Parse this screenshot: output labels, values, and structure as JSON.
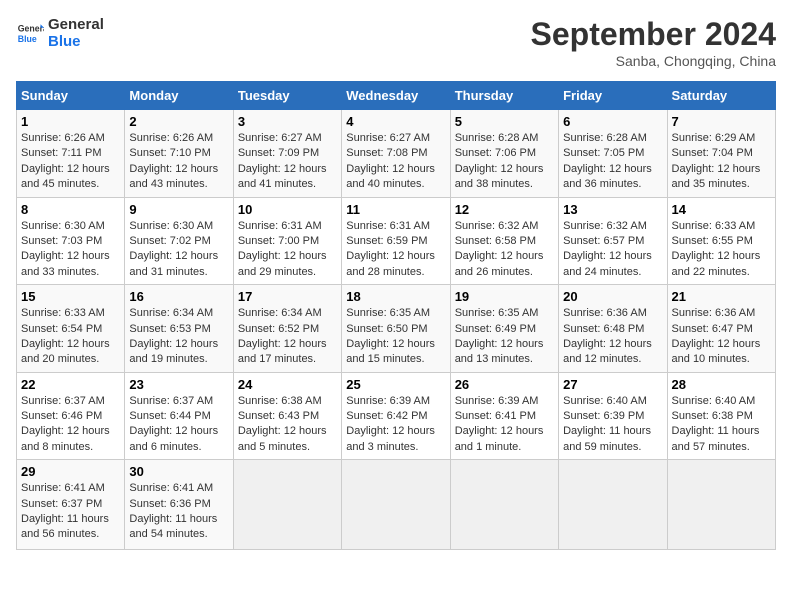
{
  "header": {
    "logo_line1": "General",
    "logo_line2": "Blue",
    "month": "September 2024",
    "location": "Sanba, Chongqing, China"
  },
  "weekdays": [
    "Sunday",
    "Monday",
    "Tuesday",
    "Wednesday",
    "Thursday",
    "Friday",
    "Saturday"
  ],
  "weeks": [
    [
      {
        "day": "1",
        "info": "Sunrise: 6:26 AM\nSunset: 7:11 PM\nDaylight: 12 hours\nand 45 minutes."
      },
      {
        "day": "2",
        "info": "Sunrise: 6:26 AM\nSunset: 7:10 PM\nDaylight: 12 hours\nand 43 minutes."
      },
      {
        "day": "3",
        "info": "Sunrise: 6:27 AM\nSunset: 7:09 PM\nDaylight: 12 hours\nand 41 minutes."
      },
      {
        "day": "4",
        "info": "Sunrise: 6:27 AM\nSunset: 7:08 PM\nDaylight: 12 hours\nand 40 minutes."
      },
      {
        "day": "5",
        "info": "Sunrise: 6:28 AM\nSunset: 7:06 PM\nDaylight: 12 hours\nand 38 minutes."
      },
      {
        "day": "6",
        "info": "Sunrise: 6:28 AM\nSunset: 7:05 PM\nDaylight: 12 hours\nand 36 minutes."
      },
      {
        "day": "7",
        "info": "Sunrise: 6:29 AM\nSunset: 7:04 PM\nDaylight: 12 hours\nand 35 minutes."
      }
    ],
    [
      {
        "day": "8",
        "info": "Sunrise: 6:30 AM\nSunset: 7:03 PM\nDaylight: 12 hours\nand 33 minutes."
      },
      {
        "day": "9",
        "info": "Sunrise: 6:30 AM\nSunset: 7:02 PM\nDaylight: 12 hours\nand 31 minutes."
      },
      {
        "day": "10",
        "info": "Sunrise: 6:31 AM\nSunset: 7:00 PM\nDaylight: 12 hours\nand 29 minutes."
      },
      {
        "day": "11",
        "info": "Sunrise: 6:31 AM\nSunset: 6:59 PM\nDaylight: 12 hours\nand 28 minutes."
      },
      {
        "day": "12",
        "info": "Sunrise: 6:32 AM\nSunset: 6:58 PM\nDaylight: 12 hours\nand 26 minutes."
      },
      {
        "day": "13",
        "info": "Sunrise: 6:32 AM\nSunset: 6:57 PM\nDaylight: 12 hours\nand 24 minutes."
      },
      {
        "day": "14",
        "info": "Sunrise: 6:33 AM\nSunset: 6:55 PM\nDaylight: 12 hours\nand 22 minutes."
      }
    ],
    [
      {
        "day": "15",
        "info": "Sunrise: 6:33 AM\nSunset: 6:54 PM\nDaylight: 12 hours\nand 20 minutes."
      },
      {
        "day": "16",
        "info": "Sunrise: 6:34 AM\nSunset: 6:53 PM\nDaylight: 12 hours\nand 19 minutes."
      },
      {
        "day": "17",
        "info": "Sunrise: 6:34 AM\nSunset: 6:52 PM\nDaylight: 12 hours\nand 17 minutes."
      },
      {
        "day": "18",
        "info": "Sunrise: 6:35 AM\nSunset: 6:50 PM\nDaylight: 12 hours\nand 15 minutes."
      },
      {
        "day": "19",
        "info": "Sunrise: 6:35 AM\nSunset: 6:49 PM\nDaylight: 12 hours\nand 13 minutes."
      },
      {
        "day": "20",
        "info": "Sunrise: 6:36 AM\nSunset: 6:48 PM\nDaylight: 12 hours\nand 12 minutes."
      },
      {
        "day": "21",
        "info": "Sunrise: 6:36 AM\nSunset: 6:47 PM\nDaylight: 12 hours\nand 10 minutes."
      }
    ],
    [
      {
        "day": "22",
        "info": "Sunrise: 6:37 AM\nSunset: 6:46 PM\nDaylight: 12 hours\nand 8 minutes."
      },
      {
        "day": "23",
        "info": "Sunrise: 6:37 AM\nSunset: 6:44 PM\nDaylight: 12 hours\nand 6 minutes."
      },
      {
        "day": "24",
        "info": "Sunrise: 6:38 AM\nSunset: 6:43 PM\nDaylight: 12 hours\nand 5 minutes."
      },
      {
        "day": "25",
        "info": "Sunrise: 6:39 AM\nSunset: 6:42 PM\nDaylight: 12 hours\nand 3 minutes."
      },
      {
        "day": "26",
        "info": "Sunrise: 6:39 AM\nSunset: 6:41 PM\nDaylight: 12 hours\nand 1 minute."
      },
      {
        "day": "27",
        "info": "Sunrise: 6:40 AM\nSunset: 6:39 PM\nDaylight: 11 hours\nand 59 minutes."
      },
      {
        "day": "28",
        "info": "Sunrise: 6:40 AM\nSunset: 6:38 PM\nDaylight: 11 hours\nand 57 minutes."
      }
    ],
    [
      {
        "day": "29",
        "info": "Sunrise: 6:41 AM\nSunset: 6:37 PM\nDaylight: 11 hours\nand 56 minutes."
      },
      {
        "day": "30",
        "info": "Sunrise: 6:41 AM\nSunset: 6:36 PM\nDaylight: 11 hours\nand 54 minutes."
      },
      {
        "day": "",
        "info": ""
      },
      {
        "day": "",
        "info": ""
      },
      {
        "day": "",
        "info": ""
      },
      {
        "day": "",
        "info": ""
      },
      {
        "day": "",
        "info": ""
      }
    ]
  ]
}
